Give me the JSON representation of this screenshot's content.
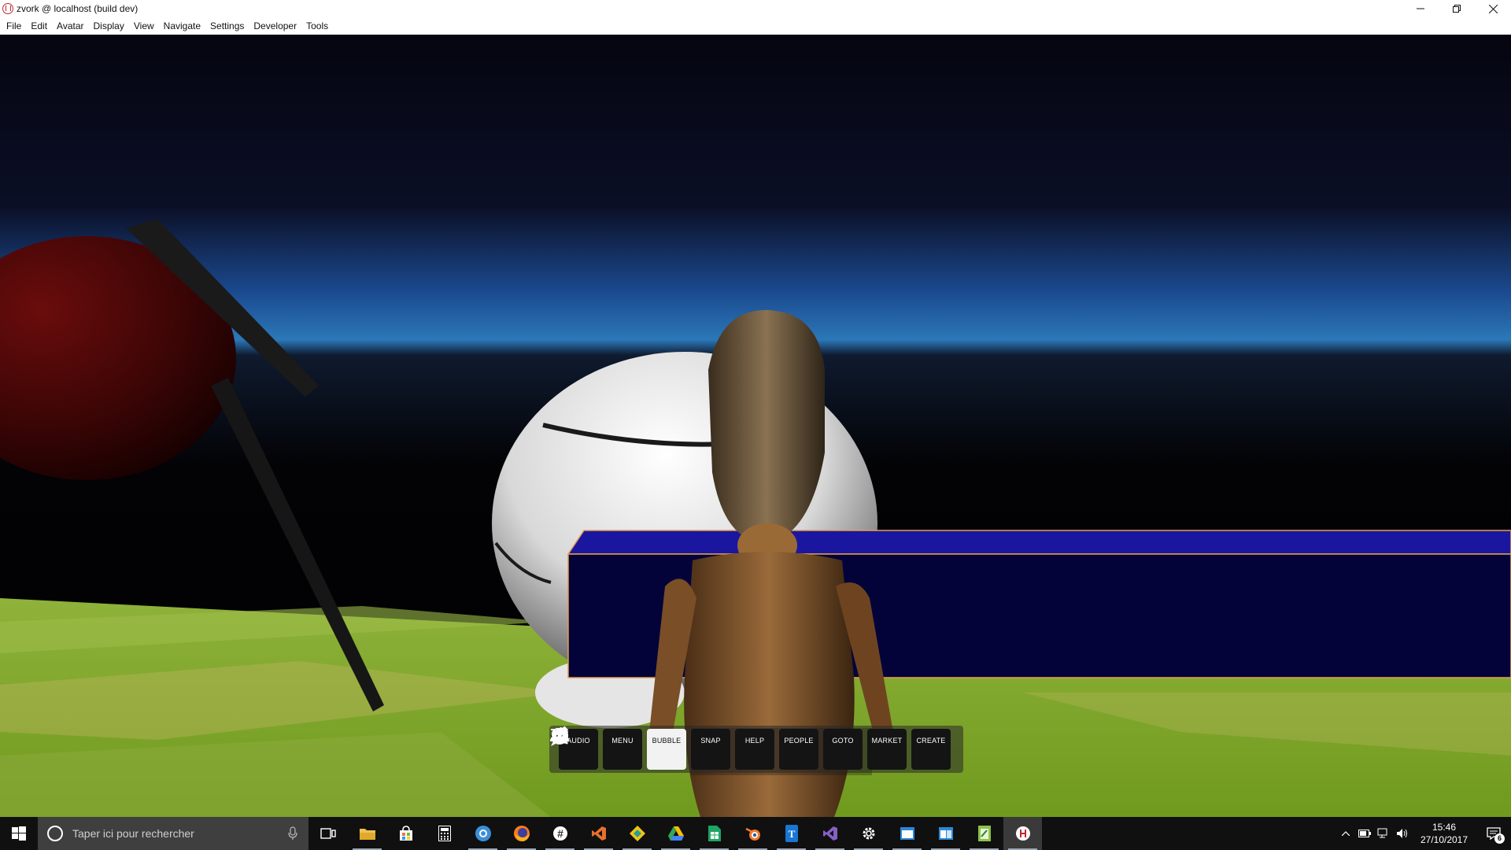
{
  "window": {
    "title": "zvork @ localhost (build dev)",
    "controls": [
      "minimize",
      "restore",
      "close"
    ]
  },
  "menu": [
    "File",
    "Edit",
    "Avatar",
    "Display",
    "View",
    "Navigate",
    "Settings",
    "Developer",
    "Tools"
  ],
  "toolbar": {
    "buttons": [
      {
        "label": "AUDIO",
        "icon": "microphone-icon",
        "active": false
      },
      {
        "label": "MENU",
        "icon": "hamburger-icon",
        "active": false
      },
      {
        "label": "BUBBLE",
        "icon": "bubble-icon",
        "active": true
      },
      {
        "label": "SNAP",
        "icon": "camera-icon",
        "active": false
      },
      {
        "label": "HELP",
        "icon": "help-icon",
        "active": false
      },
      {
        "label": "PEOPLE",
        "icon": "people-icon",
        "active": false
      },
      {
        "label": "GOTO",
        "icon": "search-icon",
        "active": false
      },
      {
        "label": "MARKET",
        "icon": "cart-icon",
        "active": false
      },
      {
        "label": "CREATE",
        "icon": "create-tools-icon",
        "active": false
      }
    ]
  },
  "taskbar": {
    "search_placeholder": "Taper ici pour rechercher",
    "apps": [
      {
        "name": "file-explorer",
        "color": "#f2c14e"
      },
      {
        "name": "store",
        "color": "#ffffff"
      },
      {
        "name": "calculator",
        "color": "#ffffff"
      },
      {
        "name": "outlook-like",
        "color": "#3b8fd9"
      },
      {
        "name": "firefox",
        "color": "#ff7a1a"
      },
      {
        "name": "slack",
        "color": "#ffffff"
      },
      {
        "name": "visual-studio-code-orange",
        "color": "#e8702a"
      },
      {
        "name": "git-kraken",
        "color": "#f0c419"
      },
      {
        "name": "google-drive",
        "color": "#34a853"
      },
      {
        "name": "sheets",
        "color": "#1fa463"
      },
      {
        "name": "blender",
        "color": "#f5792a"
      },
      {
        "name": "typora",
        "color": "#1976d2"
      },
      {
        "name": "visual-studio",
        "color": "#8661c5"
      },
      {
        "name": "settings",
        "color": "#ffffff"
      },
      {
        "name": "window-app-1",
        "color": "#2b88d8"
      },
      {
        "name": "window-app-2",
        "color": "#2b88d8"
      },
      {
        "name": "notepad-plus",
        "color": "#8bc34a"
      },
      {
        "name": "high-fidelity",
        "color": "#ffffff"
      }
    ],
    "clock_time": "15:46",
    "clock_date": "27/10/2017",
    "notification_count": "6"
  }
}
